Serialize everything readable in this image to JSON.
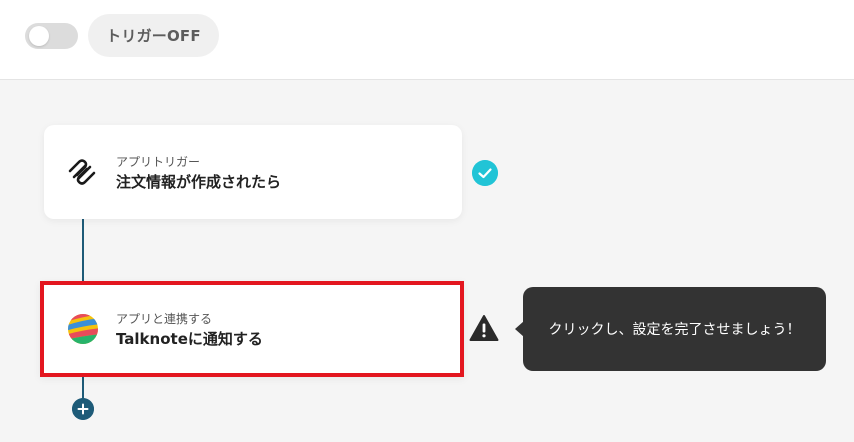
{
  "header": {
    "trigger_toggle_state": "off",
    "trigger_label": "トリガーOFF"
  },
  "flow": {
    "steps": [
      {
        "subtitle": "アプリトリガー",
        "title": "注文情報が作成されたら",
        "app_icon": "squarespace-icon",
        "status": "complete"
      },
      {
        "subtitle": "アプリと連携する",
        "title": "Talknoteに通知する",
        "app_icon": "talknote-icon",
        "status": "incomplete"
      }
    ],
    "tooltip": "クリックし、設定を完了させましょう！"
  },
  "colors": {
    "connector": "#1e5b78",
    "check": "#21c4d6",
    "highlight": "#e3161f",
    "tooltip_bg": "#333333"
  }
}
